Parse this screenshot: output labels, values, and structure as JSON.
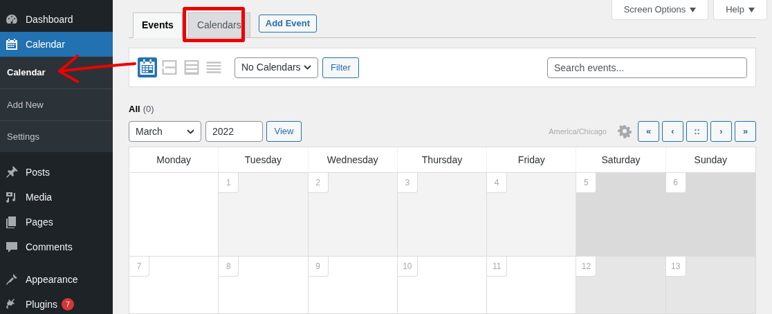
{
  "sidebar": {
    "groups": [
      {
        "items": [
          {
            "label": "Dashboard",
            "selected": false
          },
          {
            "label": "Calendar",
            "selected": true,
            "children": [
              {
                "label": "Calendar",
                "selected": true
              },
              {
                "label": "Add New",
                "selected": false
              },
              {
                "label": "Settings",
                "selected": false
              }
            ]
          }
        ]
      },
      {
        "items": [
          {
            "label": "Posts",
            "selected": false
          },
          {
            "label": "Media",
            "selected": false
          },
          {
            "label": "Pages",
            "selected": false
          },
          {
            "label": "Comments",
            "selected": false
          }
        ]
      },
      {
        "items": [
          {
            "label": "Appearance",
            "selected": false
          },
          {
            "label": "Plugins",
            "selected": false,
            "badge": "7"
          }
        ]
      }
    ]
  },
  "screen_meta": [
    "Screen Options",
    "Help"
  ],
  "tabs": [
    {
      "label": "Events",
      "selected": true
    },
    {
      "label": "Calendars",
      "selected": false,
      "highlighted": true
    }
  ],
  "add_button": "Add Event",
  "view_modes": [
    {
      "selected": true
    },
    {
      "selected": false
    },
    {
      "selected": false
    },
    {
      "selected": false
    }
  ],
  "calendar_filter": {
    "value": "No Calendars"
  },
  "filter_button": "Filter",
  "search": {
    "placeholder": "Search events..."
  },
  "status_filter": {
    "label": "All",
    "count": "(0)"
  },
  "month_select": {
    "value": "March"
  },
  "year_field": {
    "value": "2022"
  },
  "view_button": "View",
  "timezone": "America/Chicago",
  "nav_buttons": [
    "«",
    "‹",
    "::",
    "›",
    "»"
  ],
  "calendar": {
    "columns": [
      "Monday",
      "Tuesday",
      "Wednesday",
      "Thursday",
      "Friday",
      "Saturday",
      "Sunday"
    ],
    "weeks": [
      [
        {
          "kind": "blank",
          "weekend": false,
          "past": false
        },
        {
          "kind": "day",
          "day": "1",
          "weekend": false,
          "past": true
        },
        {
          "kind": "day",
          "day": "2",
          "weekend": false,
          "past": true
        },
        {
          "kind": "day",
          "day": "3",
          "weekend": false,
          "past": true
        },
        {
          "kind": "day",
          "day": "4",
          "weekend": false,
          "past": true
        },
        {
          "kind": "day",
          "day": "5",
          "weekend": true,
          "past": true
        },
        {
          "kind": "day",
          "day": "6",
          "weekend": true,
          "past": true
        }
      ],
      [
        {
          "kind": "day",
          "day": "7",
          "weekend": false,
          "past": false
        },
        {
          "kind": "day",
          "day": "8",
          "weekend": false,
          "past": false
        },
        {
          "kind": "day",
          "day": "9",
          "weekend": false,
          "past": false
        },
        {
          "kind": "day",
          "day": "10",
          "weekend": false,
          "past": false
        },
        {
          "kind": "day",
          "day": "11",
          "weekend": false,
          "past": false
        },
        {
          "kind": "day",
          "day": "12",
          "weekend": true,
          "past": false
        },
        {
          "kind": "day",
          "day": "13",
          "weekend": true,
          "past": false
        }
      ]
    ]
  },
  "annotation": {
    "arrow": true
  }
}
